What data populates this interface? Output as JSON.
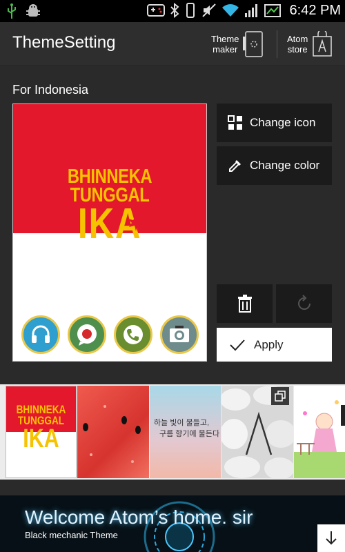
{
  "status_bar": {
    "time": "6:42 PM"
  },
  "app_bar": {
    "title": "ThemeSetting",
    "theme_maker": {
      "line1": "Theme",
      "line2": "maker"
    },
    "atom_store": {
      "line1": "Atom",
      "line2": "store"
    }
  },
  "theme": {
    "name": "For Indonesia",
    "poster": {
      "line1": "BHINNEKA",
      "line2": "TUNGGAL",
      "line3": "IKA"
    },
    "dock_icons": [
      "headphones-icon",
      "message-icon",
      "phone-icon",
      "camera-icon"
    ]
  },
  "actions": {
    "change_icon": "Change icon",
    "change_color": "Change color",
    "apply": "Apply"
  },
  "thumbnails": [
    {
      "name": "indonesia",
      "poster": {
        "line1": "BHINNEKA",
        "line2": "TUNGGAL",
        "line3": "IKA"
      },
      "selected": true
    },
    {
      "name": "watermelon"
    },
    {
      "name": "sky-korean",
      "text1": "하늘 빛이 물들고,",
      "text2": "구름 향기에 물든다"
    },
    {
      "name": "stones-atom"
    },
    {
      "name": "cartoon-girl"
    }
  ],
  "banner": {
    "title": "Welcome Atom’s home. sir",
    "subtitle": "Black mechanic Theme"
  },
  "colors": {
    "flag_red": "#e4182d",
    "poster_yellow": "#f6c300",
    "button_bg": "#1b1b1b"
  }
}
